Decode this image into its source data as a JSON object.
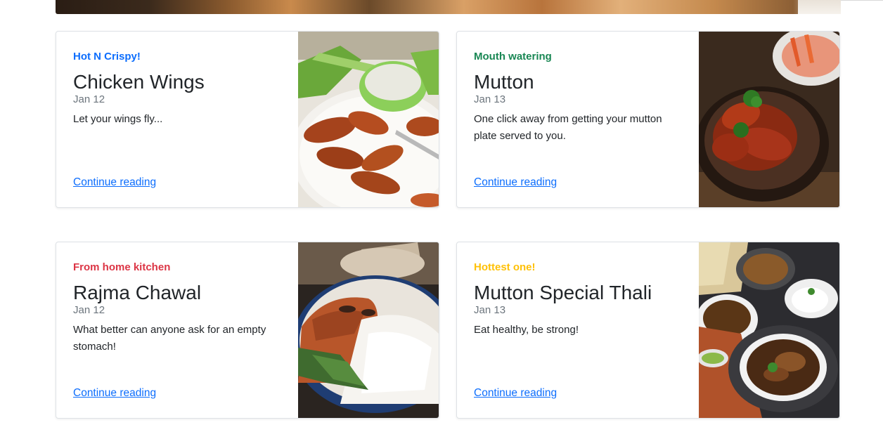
{
  "cards": [
    {
      "category": "Hot N Crispy!",
      "category_color": "#0d6efd",
      "title": "Chicken Wings",
      "date": "Jan 12",
      "excerpt": "Let your wings fly...",
      "link": "Continue reading",
      "image_icon": "chicken-wings-photo"
    },
    {
      "category": "Mouth watering",
      "category_color": "#198754",
      "title": "Mutton",
      "date": "Jan 13",
      "excerpt": "One click away from getting your mutton plate served to you.",
      "link": "Continue reading",
      "image_icon": "mutton-photo"
    },
    {
      "category": "From home kitchen",
      "category_color": "#dc3545",
      "title": "Rajma Chawal",
      "date": "Jan 12",
      "excerpt": "What better can anyone ask for an empty stomach!",
      "link": "Continue reading",
      "image_icon": "rajma-chawal-photo"
    },
    {
      "category": "Hottest one!",
      "category_color": "#ffc107",
      "title": "Mutton Special Thali",
      "date": "Jan 13",
      "excerpt": "Eat healthy, be strong!",
      "link": "Continue reading",
      "image_icon": "thali-photo"
    }
  ]
}
